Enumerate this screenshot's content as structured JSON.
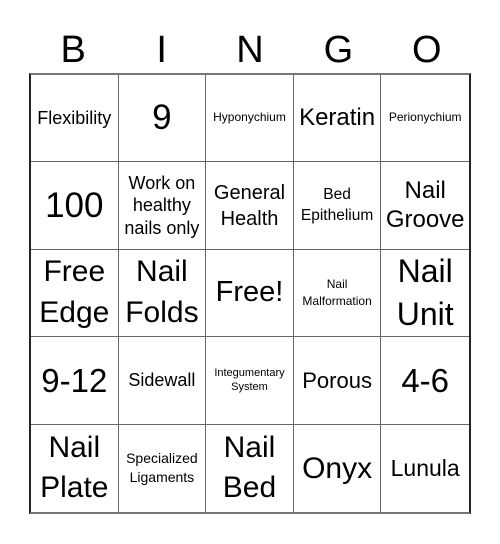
{
  "header": {
    "letters": [
      "B",
      "I",
      "N",
      "G",
      "O"
    ]
  },
  "grid": {
    "cells": [
      "Flexibility",
      "9",
      "Hyponychium",
      "Keratin",
      "Perionychium",
      "100",
      "Work on healthy nails only",
      "General Health",
      "Bed Epithelium",
      "Nail Groove",
      "Free Edge",
      "Nail Folds",
      "Free!",
      "Nail Malformation",
      "Nail Unit",
      "9-12",
      "Sidewall",
      "Integumentary System",
      "Porous",
      "4-6",
      "Nail Plate",
      "Specialized Ligaments",
      "Nail Bed",
      "Onyx",
      "Lunula"
    ],
    "free_space": "Free!"
  }
}
